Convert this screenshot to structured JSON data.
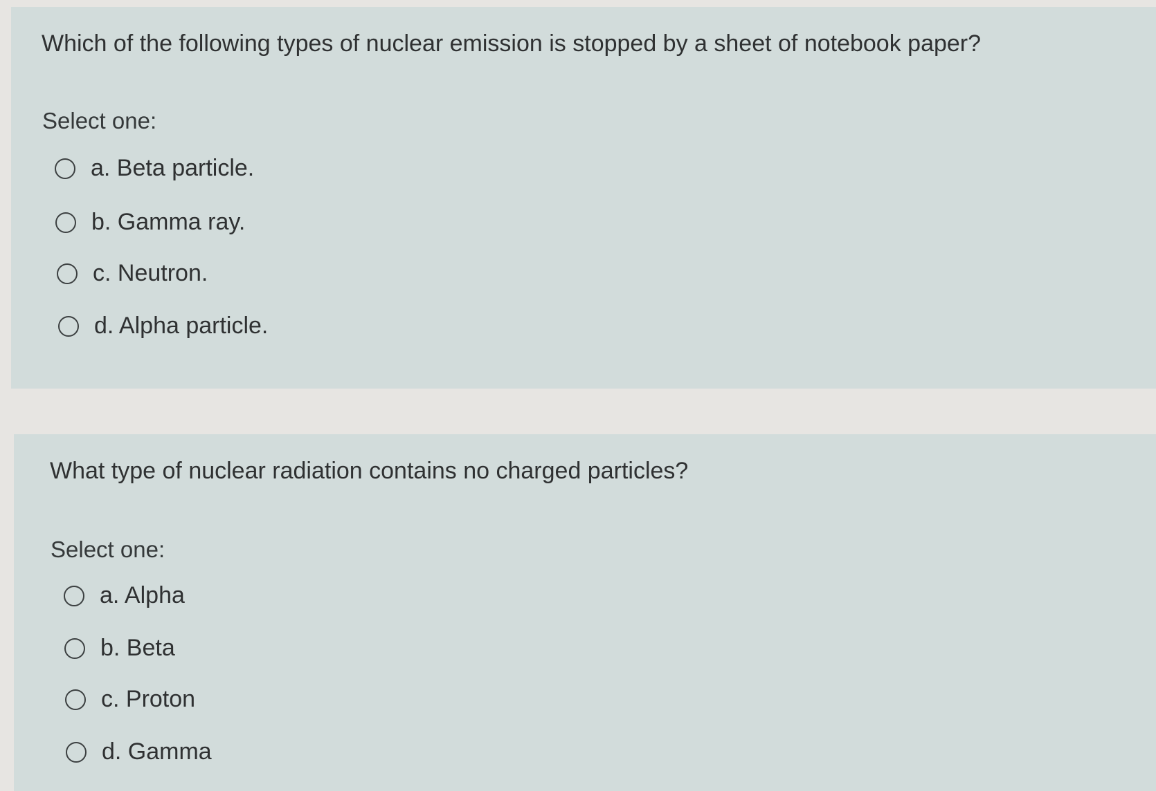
{
  "questions": [
    {
      "text": "Which of the following types of nuclear emission is stopped by a sheet of notebook paper?",
      "select_label": "Select one:",
      "options": [
        {
          "label": "a. Beta particle."
        },
        {
          "label": "b. Gamma ray."
        },
        {
          "label": "c. Neutron."
        },
        {
          "label": "d. Alpha particle."
        }
      ]
    },
    {
      "text": "What type of nuclear radiation contains no charged particles?",
      "select_label": "Select one:",
      "options": [
        {
          "label": "a. Alpha"
        },
        {
          "label": "b. Beta"
        },
        {
          "label": "c. Proton"
        },
        {
          "label": "d. Gamma"
        }
      ]
    }
  ]
}
